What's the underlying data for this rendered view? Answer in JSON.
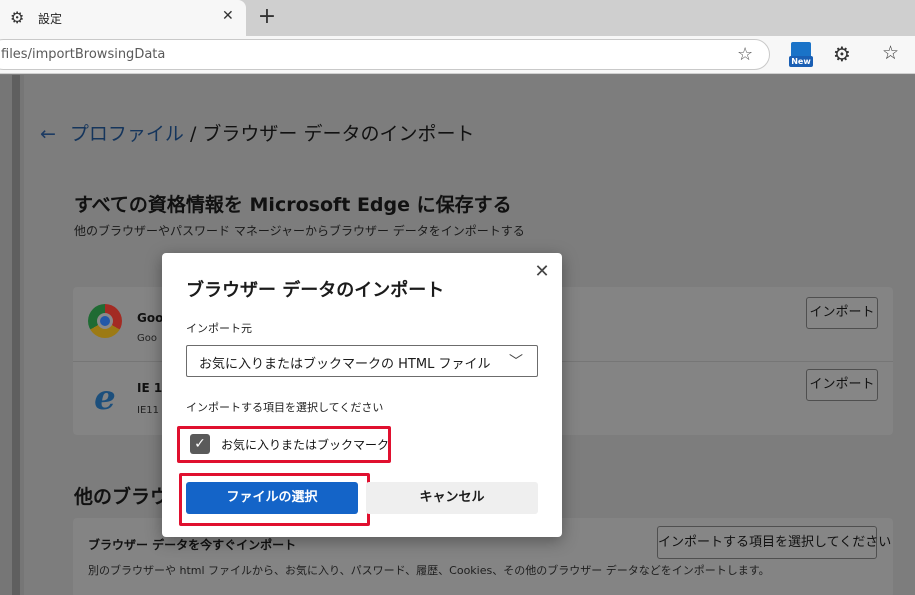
{
  "browser": {
    "tab_title": "設定",
    "tab_close": "✕",
    "new_tab": "+",
    "url": "files/importBrowsingData",
    "new_badge": "New"
  },
  "page": {
    "back_arrow": "←",
    "breadcrumb_link": "プロファイル",
    "breadcrumb_rest": " / ブラウザー データのインポート",
    "heading": "すべての資格情報を Microsoft Edge に保存する",
    "subheading": "他のブラウザーやパスワード マネージャーからブラウザー データをインポートする",
    "sources": [
      {
        "name": "Goo",
        "sub": "Goo",
        "button": "インポート"
      },
      {
        "name": "IE 11",
        "sub": "IE11",
        "button": "インポート"
      }
    ],
    "section2_heading": "他のブラウザ",
    "card2_title": "ブラウザー データを今すぐインポート",
    "card2_desc": "別のブラウザーや html ファイルから、お気に入り、パスワード、履歴、Cookies、その他のブラウザー データなどをインポートします。",
    "card2_button": "インポートする項目を選択してください"
  },
  "dialog": {
    "title": "ブラウザー データのインポート",
    "close": "✕",
    "source_label": "インポート元",
    "source_value": "お気に入りまたはブックマークの HTML ファイル",
    "items_label": "インポートする項目を選択してください",
    "checkbox_label": "お気に入りまたはブックマーク",
    "checkbox_checked": true,
    "primary_button": "ファイルの選択",
    "cancel_button": "キャンセル",
    "highlight_color": "#e0102f",
    "accent_color": "#1464c8"
  }
}
